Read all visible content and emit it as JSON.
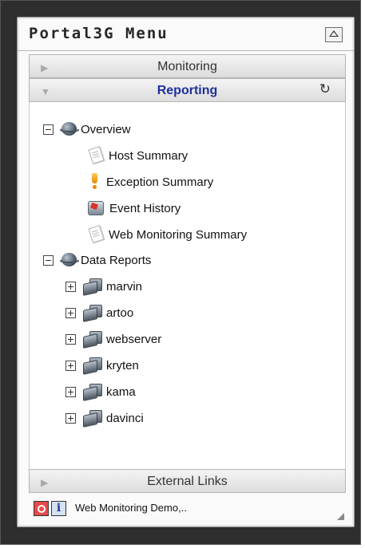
{
  "window": {
    "title": "Portal3G Menu"
  },
  "sections": {
    "monitoring": {
      "label": "Monitoring"
    },
    "reporting": {
      "label": "Reporting"
    },
    "external_links": {
      "label": "External Links"
    }
  },
  "tree": {
    "overview": {
      "label": "Overview",
      "items": [
        {
          "label": "Host Summary",
          "icon": "document-icon"
        },
        {
          "label": "Exception Summary",
          "icon": "warning-icon"
        },
        {
          "label": "Event History",
          "icon": "event-icon"
        },
        {
          "label": "Web Monitoring Summary",
          "icon": "document-icon"
        }
      ]
    },
    "data_reports": {
      "label": "Data Reports",
      "hosts": [
        "marvin",
        "artoo",
        "webserver",
        "kryten",
        "kama",
        "davinci"
      ]
    }
  },
  "status_bar": {
    "text": "Web Monitoring Demo,..",
    "info_label": "i"
  }
}
